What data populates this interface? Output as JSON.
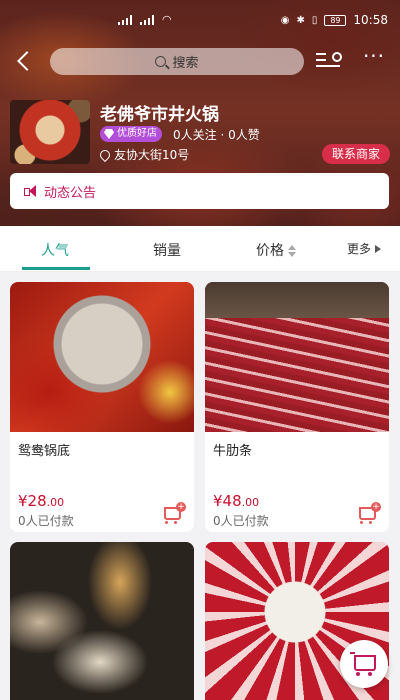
{
  "status_bar": {
    "time": "10:58",
    "battery": "89"
  },
  "search": {
    "placeholder": "搜索"
  },
  "shop": {
    "name": "老佛爷市井火锅",
    "badge": "优质好店",
    "stats": "0人关注 · 0人赞",
    "address": "友协大街10号",
    "contact_label": "联系商家"
  },
  "notice": {
    "label": "动态公告"
  },
  "tabs": [
    {
      "label": "人气"
    },
    {
      "label": "销量"
    },
    {
      "label": "价格"
    },
    {
      "label": "更多"
    }
  ],
  "products": [
    {
      "title": "鸳鸯锅底",
      "price_int": "¥28",
      "price_dec": ".00",
      "sold": "0人已付款"
    },
    {
      "title": "牛肋条",
      "price_int": "¥48",
      "price_dec": ".00",
      "sold": "0人已付款"
    },
    {
      "title": "",
      "price_int": "",
      "price_dec": "",
      "sold": ""
    },
    {
      "title": "",
      "price_int": "",
      "price_dec": "",
      "sold": ""
    }
  ],
  "colors": {
    "accent": "#1a9e8f",
    "price": "#c8102e",
    "primary_red": "#d92e4a",
    "notice": "#c2185b",
    "badge": "#b24ed8"
  },
  "icons": [
    "back-icon",
    "search-icon",
    "filter-search-icon",
    "more-icon",
    "location-pin-icon",
    "speaker-icon",
    "sort-icon",
    "triangle-right-icon",
    "add-to-cart-icon",
    "cart-icon"
  ]
}
